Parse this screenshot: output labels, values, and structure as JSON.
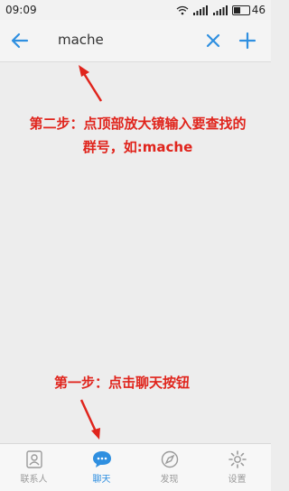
{
  "status": {
    "time": "09:09",
    "battery": "46",
    "battery_level": 0.46
  },
  "search": {
    "back_icon": "arrow-left-icon",
    "query": "mache",
    "clear_icon": "close-icon",
    "add_icon": "plus-icon"
  },
  "annotations": {
    "step2_line1": "第二步：点顶部放大镜输入要查找的",
    "step2_line2": "群号，如:mache",
    "step1": "第一步：点击聊天按钮"
  },
  "tabs": [
    {
      "label": "联系人",
      "icon": "contacts-icon",
      "active": false
    },
    {
      "label": "聊天",
      "icon": "chat-icon",
      "active": true
    },
    {
      "label": "发现",
      "icon": "discover-icon",
      "active": false
    },
    {
      "label": "设置",
      "icon": "settings-icon",
      "active": false
    }
  ],
  "colors": {
    "accent": "#2f8fe0",
    "annotation": "#e0241c",
    "background": "#ededed"
  }
}
